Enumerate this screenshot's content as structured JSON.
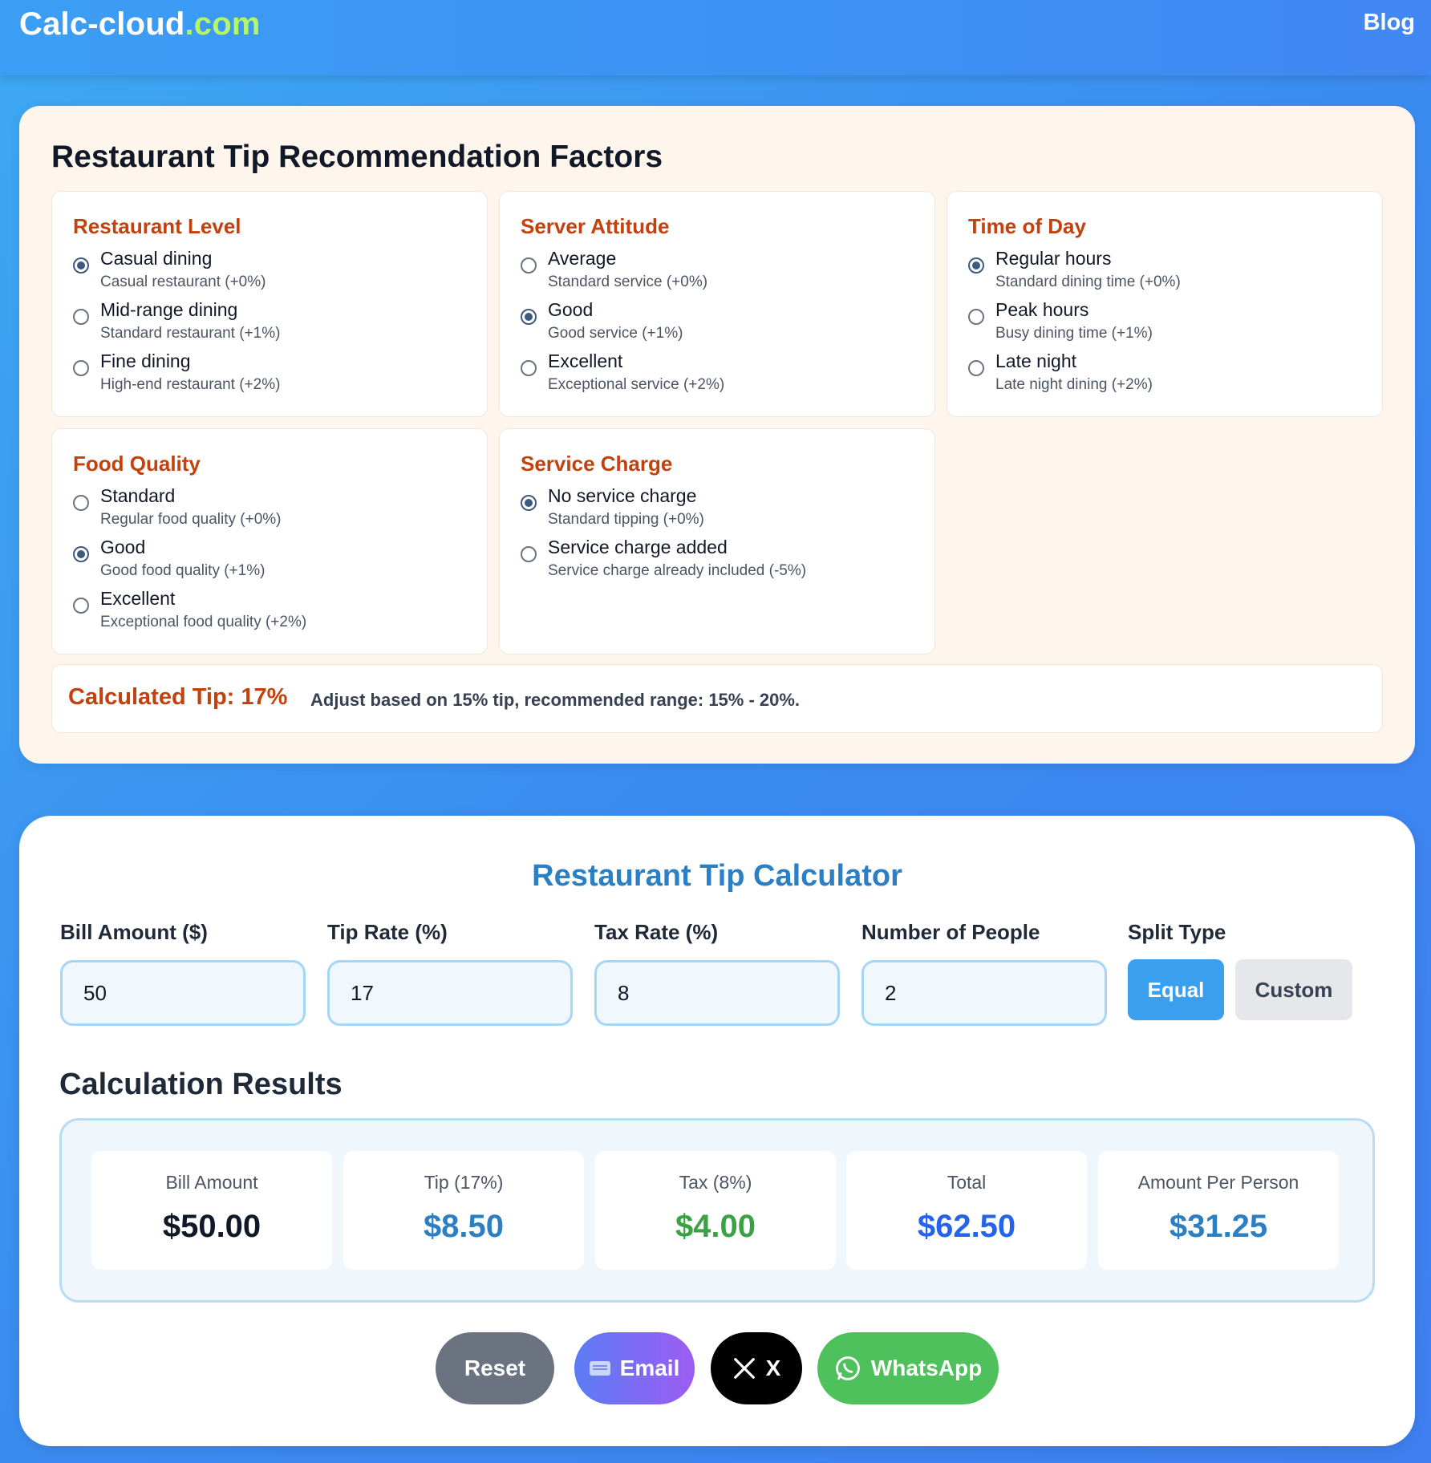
{
  "header": {
    "logo_main": "Calc-cloud",
    "logo_tld": ".com",
    "blog_label": "Blog"
  },
  "factors": {
    "title": "Restaurant Tip Recommendation Factors",
    "groups": [
      {
        "title": "Restaurant Level",
        "options": [
          {
            "label": "Casual dining",
            "desc": "Casual restaurant (+0%)",
            "checked": true
          },
          {
            "label": "Mid-range dining",
            "desc": "Standard restaurant (+1%)",
            "checked": false
          },
          {
            "label": "Fine dining",
            "desc": "High-end restaurant (+2%)",
            "checked": false
          }
        ]
      },
      {
        "title": "Server Attitude",
        "options": [
          {
            "label": "Average",
            "desc": "Standard service (+0%)",
            "checked": false
          },
          {
            "label": "Good",
            "desc": "Good service (+1%)",
            "checked": true
          },
          {
            "label": "Excellent",
            "desc": "Exceptional service (+2%)",
            "checked": false
          }
        ]
      },
      {
        "title": "Time of Day",
        "options": [
          {
            "label": "Regular hours",
            "desc": "Standard dining time (+0%)",
            "checked": true
          },
          {
            "label": "Peak hours",
            "desc": "Busy dining time (+1%)",
            "checked": false
          },
          {
            "label": "Late night",
            "desc": "Late night dining (+2%)",
            "checked": false
          }
        ]
      },
      {
        "title": "Food Quality",
        "options": [
          {
            "label": "Standard",
            "desc": "Regular food quality (+0%)",
            "checked": false
          },
          {
            "label": "Good",
            "desc": "Good food quality (+1%)",
            "checked": true
          },
          {
            "label": "Excellent",
            "desc": "Exceptional food quality (+2%)",
            "checked": false
          }
        ]
      },
      {
        "title": "Service Charge",
        "options": [
          {
            "label": "No service charge",
            "desc": "Standard tipping (+0%)",
            "checked": true
          },
          {
            "label": "Service charge added",
            "desc": "Service charge already included (-5%)",
            "checked": false
          }
        ]
      }
    ],
    "calculated_tip": "Calculated Tip: 17%",
    "note": "Adjust based on 15% tip, recommended range: 15% - 20%."
  },
  "calculator": {
    "title": "Restaurant Tip Calculator",
    "fields": {
      "bill": {
        "label": "Bill Amount ($)",
        "value": "50"
      },
      "tip": {
        "label": "Tip Rate (%)",
        "value": "17"
      },
      "tax": {
        "label": "Tax Rate (%)",
        "value": "8"
      },
      "people": {
        "label": "Number of People",
        "value": "2"
      }
    },
    "split": {
      "label": "Split Type",
      "equal": "Equal",
      "custom": "Custom",
      "selected": "Equal"
    },
    "results_title": "Calculation Results",
    "results": {
      "bill": {
        "label": "Bill Amount",
        "value": "$50.00"
      },
      "tip": {
        "label": "Tip (17%)",
        "value": "$8.50"
      },
      "tax": {
        "label": "Tax (8%)",
        "value": "$4.00"
      },
      "total": {
        "label": "Total",
        "value": "$62.50"
      },
      "per_person": {
        "label": "Amount Per Person",
        "value": "$31.25"
      }
    },
    "actions": {
      "reset": "Reset",
      "email": "Email",
      "x": "X",
      "whatsapp": "WhatsApp"
    }
  },
  "colors": {
    "accent_orange": "#c2410c",
    "accent_blue": "#2b7fc2",
    "tip_value": "#2b7fc2",
    "tax_value": "#3aa245",
    "total_value": "#2563eb",
    "per_person_value": "#2b7fc2",
    "bill_value": "#111827"
  }
}
